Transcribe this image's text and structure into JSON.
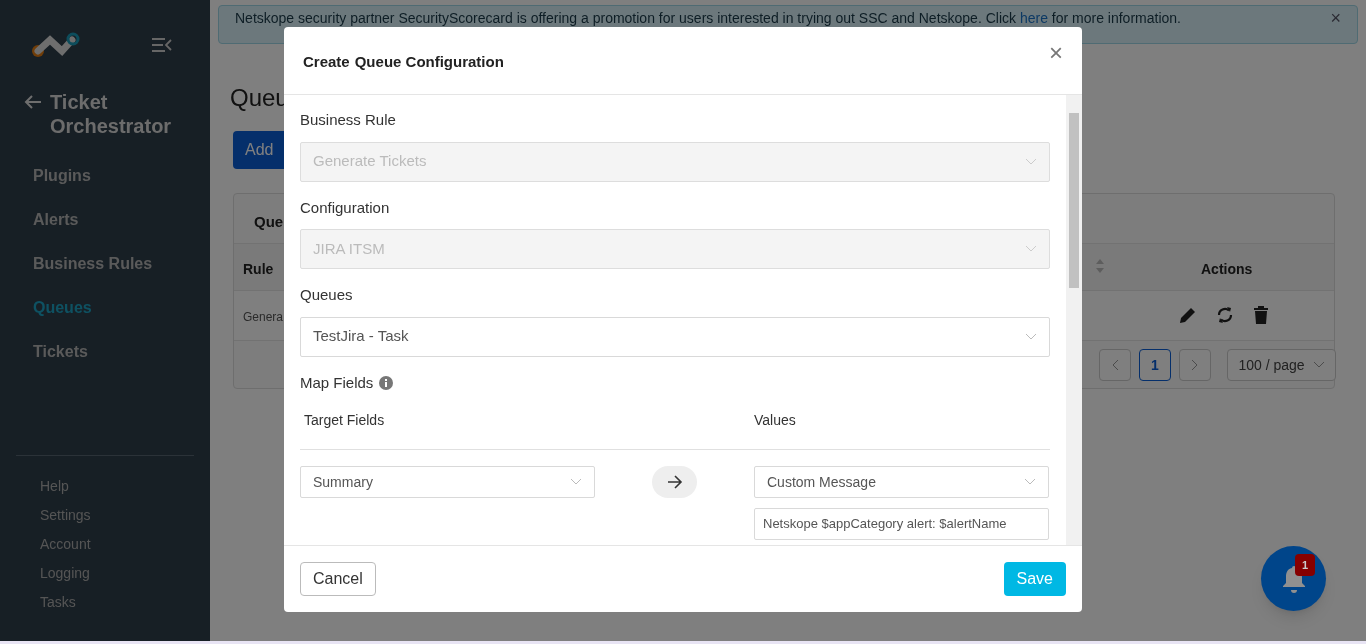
{
  "sidebar": {
    "title": "Ticket Orchestrator",
    "nav": [
      {
        "label": "Plugins",
        "selected": false
      },
      {
        "label": "Alerts",
        "selected": false
      },
      {
        "label": "Business Rules",
        "selected": false
      },
      {
        "label": "Queues",
        "selected": true
      },
      {
        "label": "Tickets",
        "selected": false
      }
    ],
    "footer_links": [
      "Help",
      "Settings",
      "Account",
      "Logging",
      "Tasks"
    ]
  },
  "banner": {
    "text": "Netskope security partner SecurityScorecard is offering a promotion for users interested in trying out SSC and Netskope. Click",
    "link": "here",
    "text_after": "for more information.",
    "close": "×"
  },
  "page": {
    "title": "Queu",
    "add_button": "Add",
    "card_title": "Que",
    "columns": [
      "Rule",
      "Actions"
    ],
    "row_cell": "Genera",
    "pagination": {
      "pages": [
        {
          "label": "1",
          "selected": true
        }
      ],
      "page_size": "100 / page"
    }
  },
  "modal": {
    "title_prefix": "Create",
    "title": "Queue Configuration",
    "close": "×",
    "fields": [
      {
        "label": "Business Rule",
        "value": "Generate Tickets",
        "disabled": true
      },
      {
        "label": "Configuration",
        "value": "JIRA ITSM",
        "disabled": true
      },
      {
        "label": "Queues",
        "value": "TestJira - Task",
        "disabled": false
      }
    ],
    "map_fields": {
      "label": "Map Fields",
      "target_header": "Target Fields",
      "values_header": "Values",
      "rows": [
        {
          "target": "Summary",
          "value_type": "Custom Message",
          "value": "Netskope $appCategory alert: $alertName"
        }
      ]
    },
    "cancel": "Cancel",
    "save": "Save"
  },
  "notifications": {
    "count": "1"
  }
}
